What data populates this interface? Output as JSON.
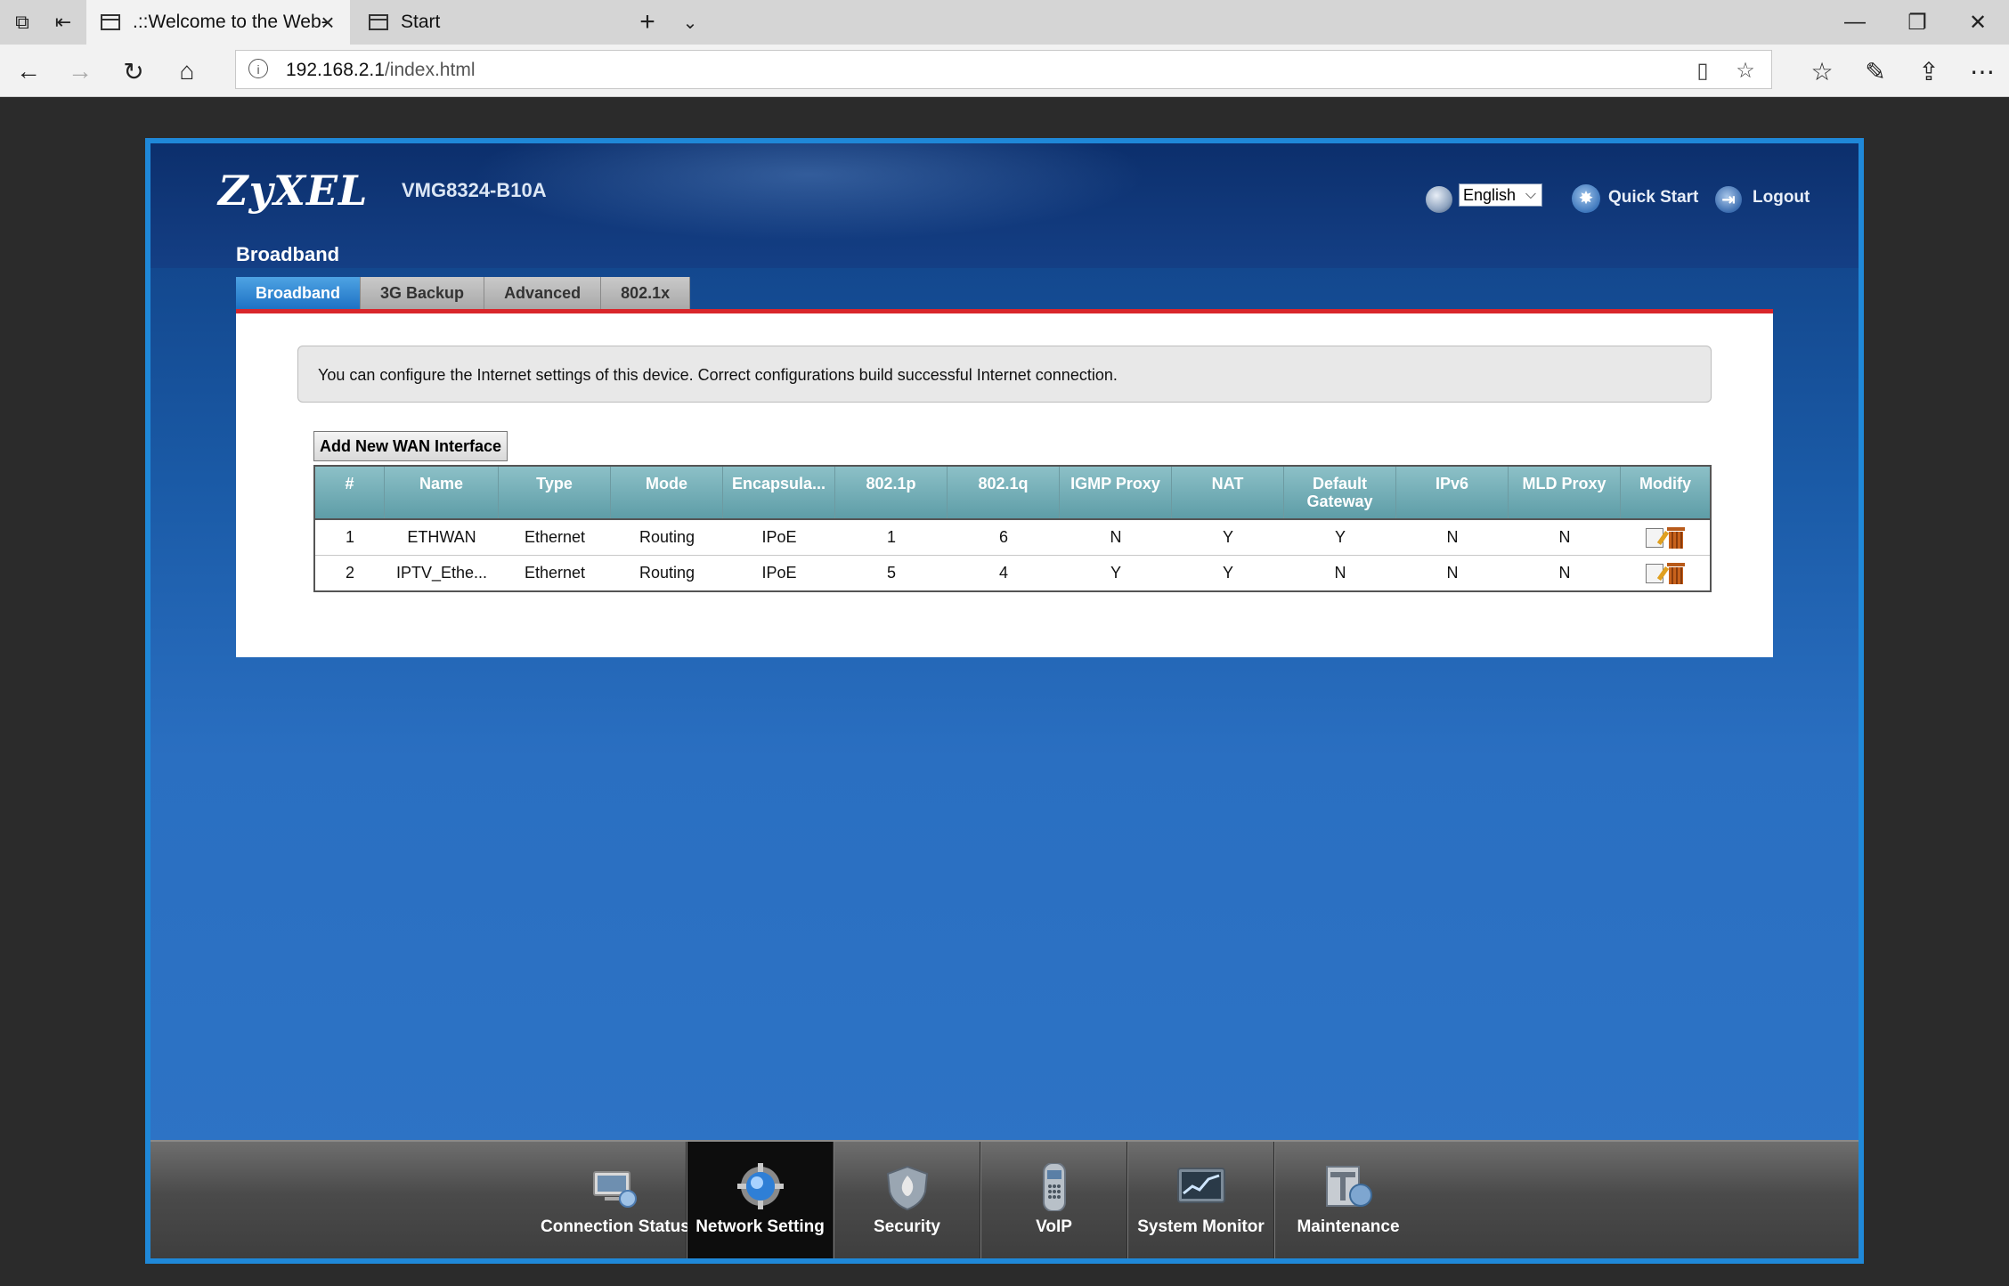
{
  "browser": {
    "tabs": [
      {
        "title": ".::Welcome to the Web-",
        "active": true
      },
      {
        "title": "Start",
        "active": false
      }
    ],
    "url_host": "192.168.2.1",
    "url_path": "/index.html"
  },
  "header": {
    "logo": "ZyXEL",
    "model": "VMG8324-B10A",
    "language": "English",
    "quick_start": "Quick Start",
    "logout": "Logout"
  },
  "section_title": "Broadband",
  "subtabs": [
    {
      "label": "Broadband",
      "active": true
    },
    {
      "label": "3G Backup",
      "active": false
    },
    {
      "label": "Advanced",
      "active": false
    },
    {
      "label": "802.1x",
      "active": false
    }
  ],
  "info_text": "You can configure the Internet settings of this device. Correct configurations build successful Internet connection.",
  "add_button": "Add New WAN Interface",
  "table": {
    "columns": [
      "#",
      "Name",
      "Type",
      "Mode",
      "Encapsula...",
      "802.1p",
      "802.1q",
      "IGMP Proxy",
      "NAT",
      "Default Gateway",
      "IPv6",
      "MLD Proxy",
      "Modify"
    ],
    "rows": [
      [
        "1",
        "ETHWAN",
        "Ethernet",
        "Routing",
        "IPoE",
        "1",
        "6",
        "N",
        "Y",
        "Y",
        "N",
        "N"
      ],
      [
        "2",
        "IPTV_Ethe...",
        "Ethernet",
        "Routing",
        "IPoE",
        "5",
        "4",
        "Y",
        "Y",
        "N",
        "N",
        "N"
      ]
    ]
  },
  "bottom_nav": [
    {
      "label": "Connection Status",
      "icon": "connection-status-icon",
      "active": false
    },
    {
      "label": "Network Setting",
      "icon": "network-setting-icon",
      "active": true
    },
    {
      "label": "Security",
      "icon": "security-icon",
      "active": false
    },
    {
      "label": "VoIP",
      "icon": "voip-icon",
      "active": false
    },
    {
      "label": "System Monitor",
      "icon": "system-monitor-icon",
      "active": false
    },
    {
      "label": "Maintenance",
      "icon": "maintenance-icon",
      "active": false
    }
  ],
  "colors": {
    "frame_border": "#1f88d8",
    "tab_active": "#1e72c4",
    "tab_underline": "#d9262b",
    "table_header": "#5e9da7"
  }
}
